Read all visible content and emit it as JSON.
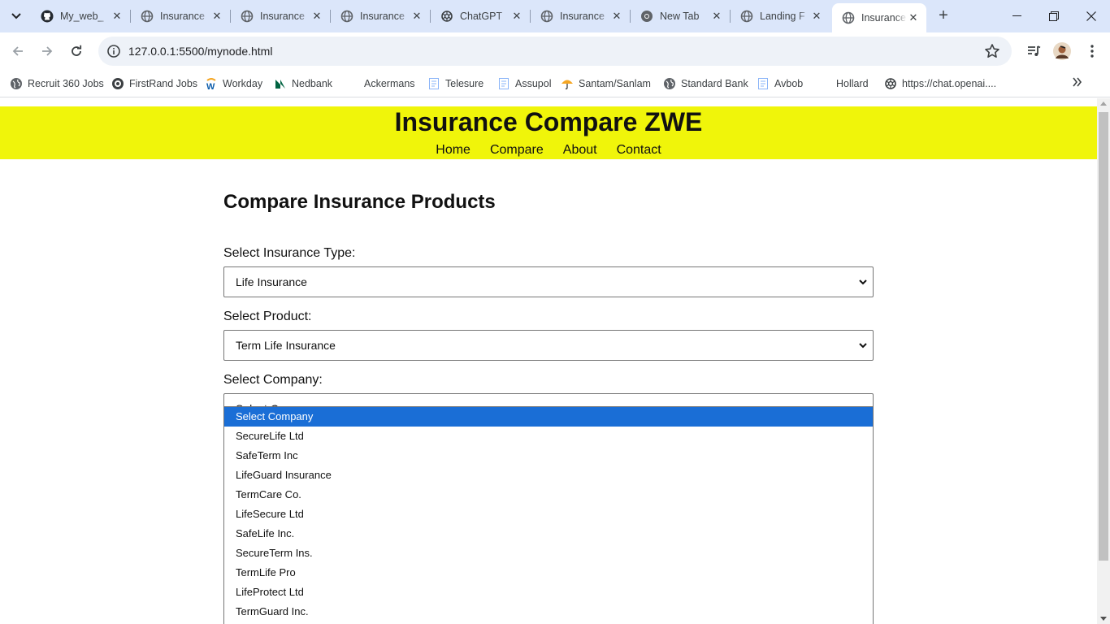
{
  "browser": {
    "tabs": [
      {
        "title": "My_web_",
        "icon": "github-icon",
        "active": false
      },
      {
        "title": "Insurance",
        "icon": "globe-icon",
        "active": false
      },
      {
        "title": "Insurance",
        "icon": "globe-icon",
        "active": false
      },
      {
        "title": "Insurance",
        "icon": "globe-icon",
        "active": false
      },
      {
        "title": "ChatGPT",
        "icon": "openai-icon",
        "active": false
      },
      {
        "title": "Insurance",
        "icon": "globe-icon",
        "active": false
      },
      {
        "title": "New Tab",
        "icon": "chrome-icon",
        "active": false
      },
      {
        "title": "Landing F",
        "icon": "globe-icon",
        "active": false
      },
      {
        "title": "Insurance",
        "icon": "globe-icon",
        "active": true
      }
    ],
    "url": "127.0.0.1:5500/mynode.html",
    "bookmarks": [
      {
        "label": "Recruit 360 Jobs",
        "icon": "globe-icon"
      },
      {
        "label": "FirstRand Jobs",
        "icon": "firstrand-icon"
      },
      {
        "label": "Workday",
        "icon": "workday-icon"
      },
      {
        "label": "Nedbank",
        "icon": "nedbank-icon"
      },
      {
        "label": "Ackermans",
        "icon": "none"
      },
      {
        "label": "Telesure",
        "icon": "document-icon"
      },
      {
        "label": "Assupol",
        "icon": "document-icon"
      },
      {
        "label": "Santam/Sanlam",
        "icon": "umbrella-icon"
      },
      {
        "label": "Standard Bank",
        "icon": "globe-icon"
      },
      {
        "label": "Avbob",
        "icon": "document-icon"
      },
      {
        "label": "Hollard",
        "icon": "none"
      },
      {
        "label": "https://chat.openai....",
        "icon": "openai-icon"
      }
    ]
  },
  "site": {
    "title": "Insurance Compare ZWE",
    "nav": [
      "Home",
      "Compare",
      "About",
      "Contact"
    ],
    "header_color": "#f0f50a"
  },
  "compare": {
    "heading": "Compare Insurance Products",
    "type_label": "Select Insurance Type:",
    "type_value": "Life Insurance",
    "product_label": "Select Product:",
    "product_value": "Term Life Insurance",
    "company_label": "Select Company:",
    "company_value": "Select Company",
    "company_options": [
      "Select Company",
      "SecureLife Ltd",
      "SafeTerm Inc",
      "LifeGuard Insurance",
      "TermCare Co.",
      "LifeSecure Ltd",
      "SafeLife Inc.",
      "SecureTerm Ins.",
      "TermLife Pro",
      "LifeProtect Ltd",
      "TermGuard Inc."
    ],
    "highlight_color": "#1a6ed6"
  }
}
